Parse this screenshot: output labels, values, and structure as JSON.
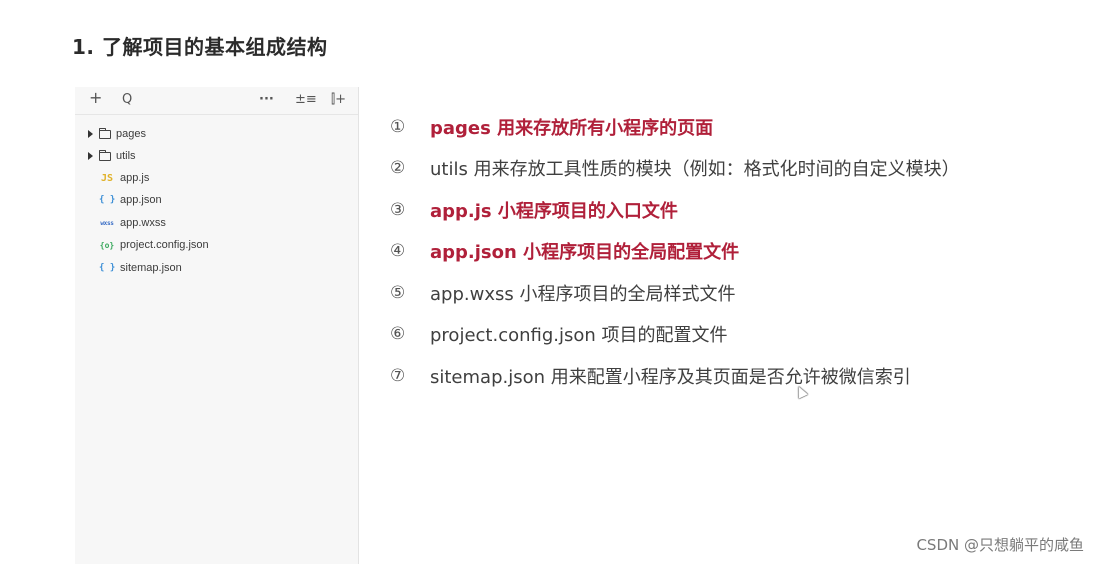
{
  "heading": "1. 了解项目的基本组成结构",
  "explorer": {
    "toolbar": {
      "add": "+",
      "search": "Q",
      "more": "···",
      "sort": "±≡",
      "collapse": "⫿+"
    },
    "tree": [
      {
        "type": "folder",
        "label": "pages",
        "icon": "folder-icon"
      },
      {
        "type": "folder",
        "label": "utils",
        "icon": "folder-icon"
      },
      {
        "type": "file",
        "label": "app.js",
        "icon_glyph": "JS",
        "icon": "js-file-icon"
      },
      {
        "type": "file",
        "label": "app.json",
        "icon_glyph": "{ }",
        "icon": "json-file-icon"
      },
      {
        "type": "file",
        "label": "app.wxss",
        "icon_glyph": "wxss",
        "icon": "wxss-file-icon"
      },
      {
        "type": "file",
        "label": "project.config.json",
        "icon_glyph": "{o}",
        "icon": "config-file-icon"
      },
      {
        "type": "file",
        "label": "sitemap.json",
        "icon_glyph": "{ }",
        "icon": "json-file-icon"
      }
    ]
  },
  "items": [
    {
      "num": "①",
      "text": "pages 用来存放所有小程序的页面",
      "highlight": true
    },
    {
      "num": "②",
      "text": "utils 用来存放工具性质的模块（例如：格式化时间的自定义模块）",
      "highlight": false
    },
    {
      "num": "③",
      "text": "app.js 小程序项目的入口文件",
      "highlight": true
    },
    {
      "num": "④",
      "text": "app.json 小程序项目的全局配置文件",
      "highlight": true
    },
    {
      "num": "⑤",
      "text": "app.wxss 小程序项目的全局样式文件",
      "highlight": false
    },
    {
      "num": "⑥",
      "text": "project.config.json 项目的配置文件",
      "highlight": false
    },
    {
      "num": "⑦",
      "text": "sitemap.json 用来配置小程序及其页面是否允许被微信索引",
      "highlight": false
    }
  ],
  "watermark": "CSDN @只想躺平的咸鱼",
  "colors": {
    "highlight": "#b0203a",
    "js_icon": "#e0b22a",
    "json_icon": "#3d8fd6",
    "config_icon": "#3aa85d"
  }
}
